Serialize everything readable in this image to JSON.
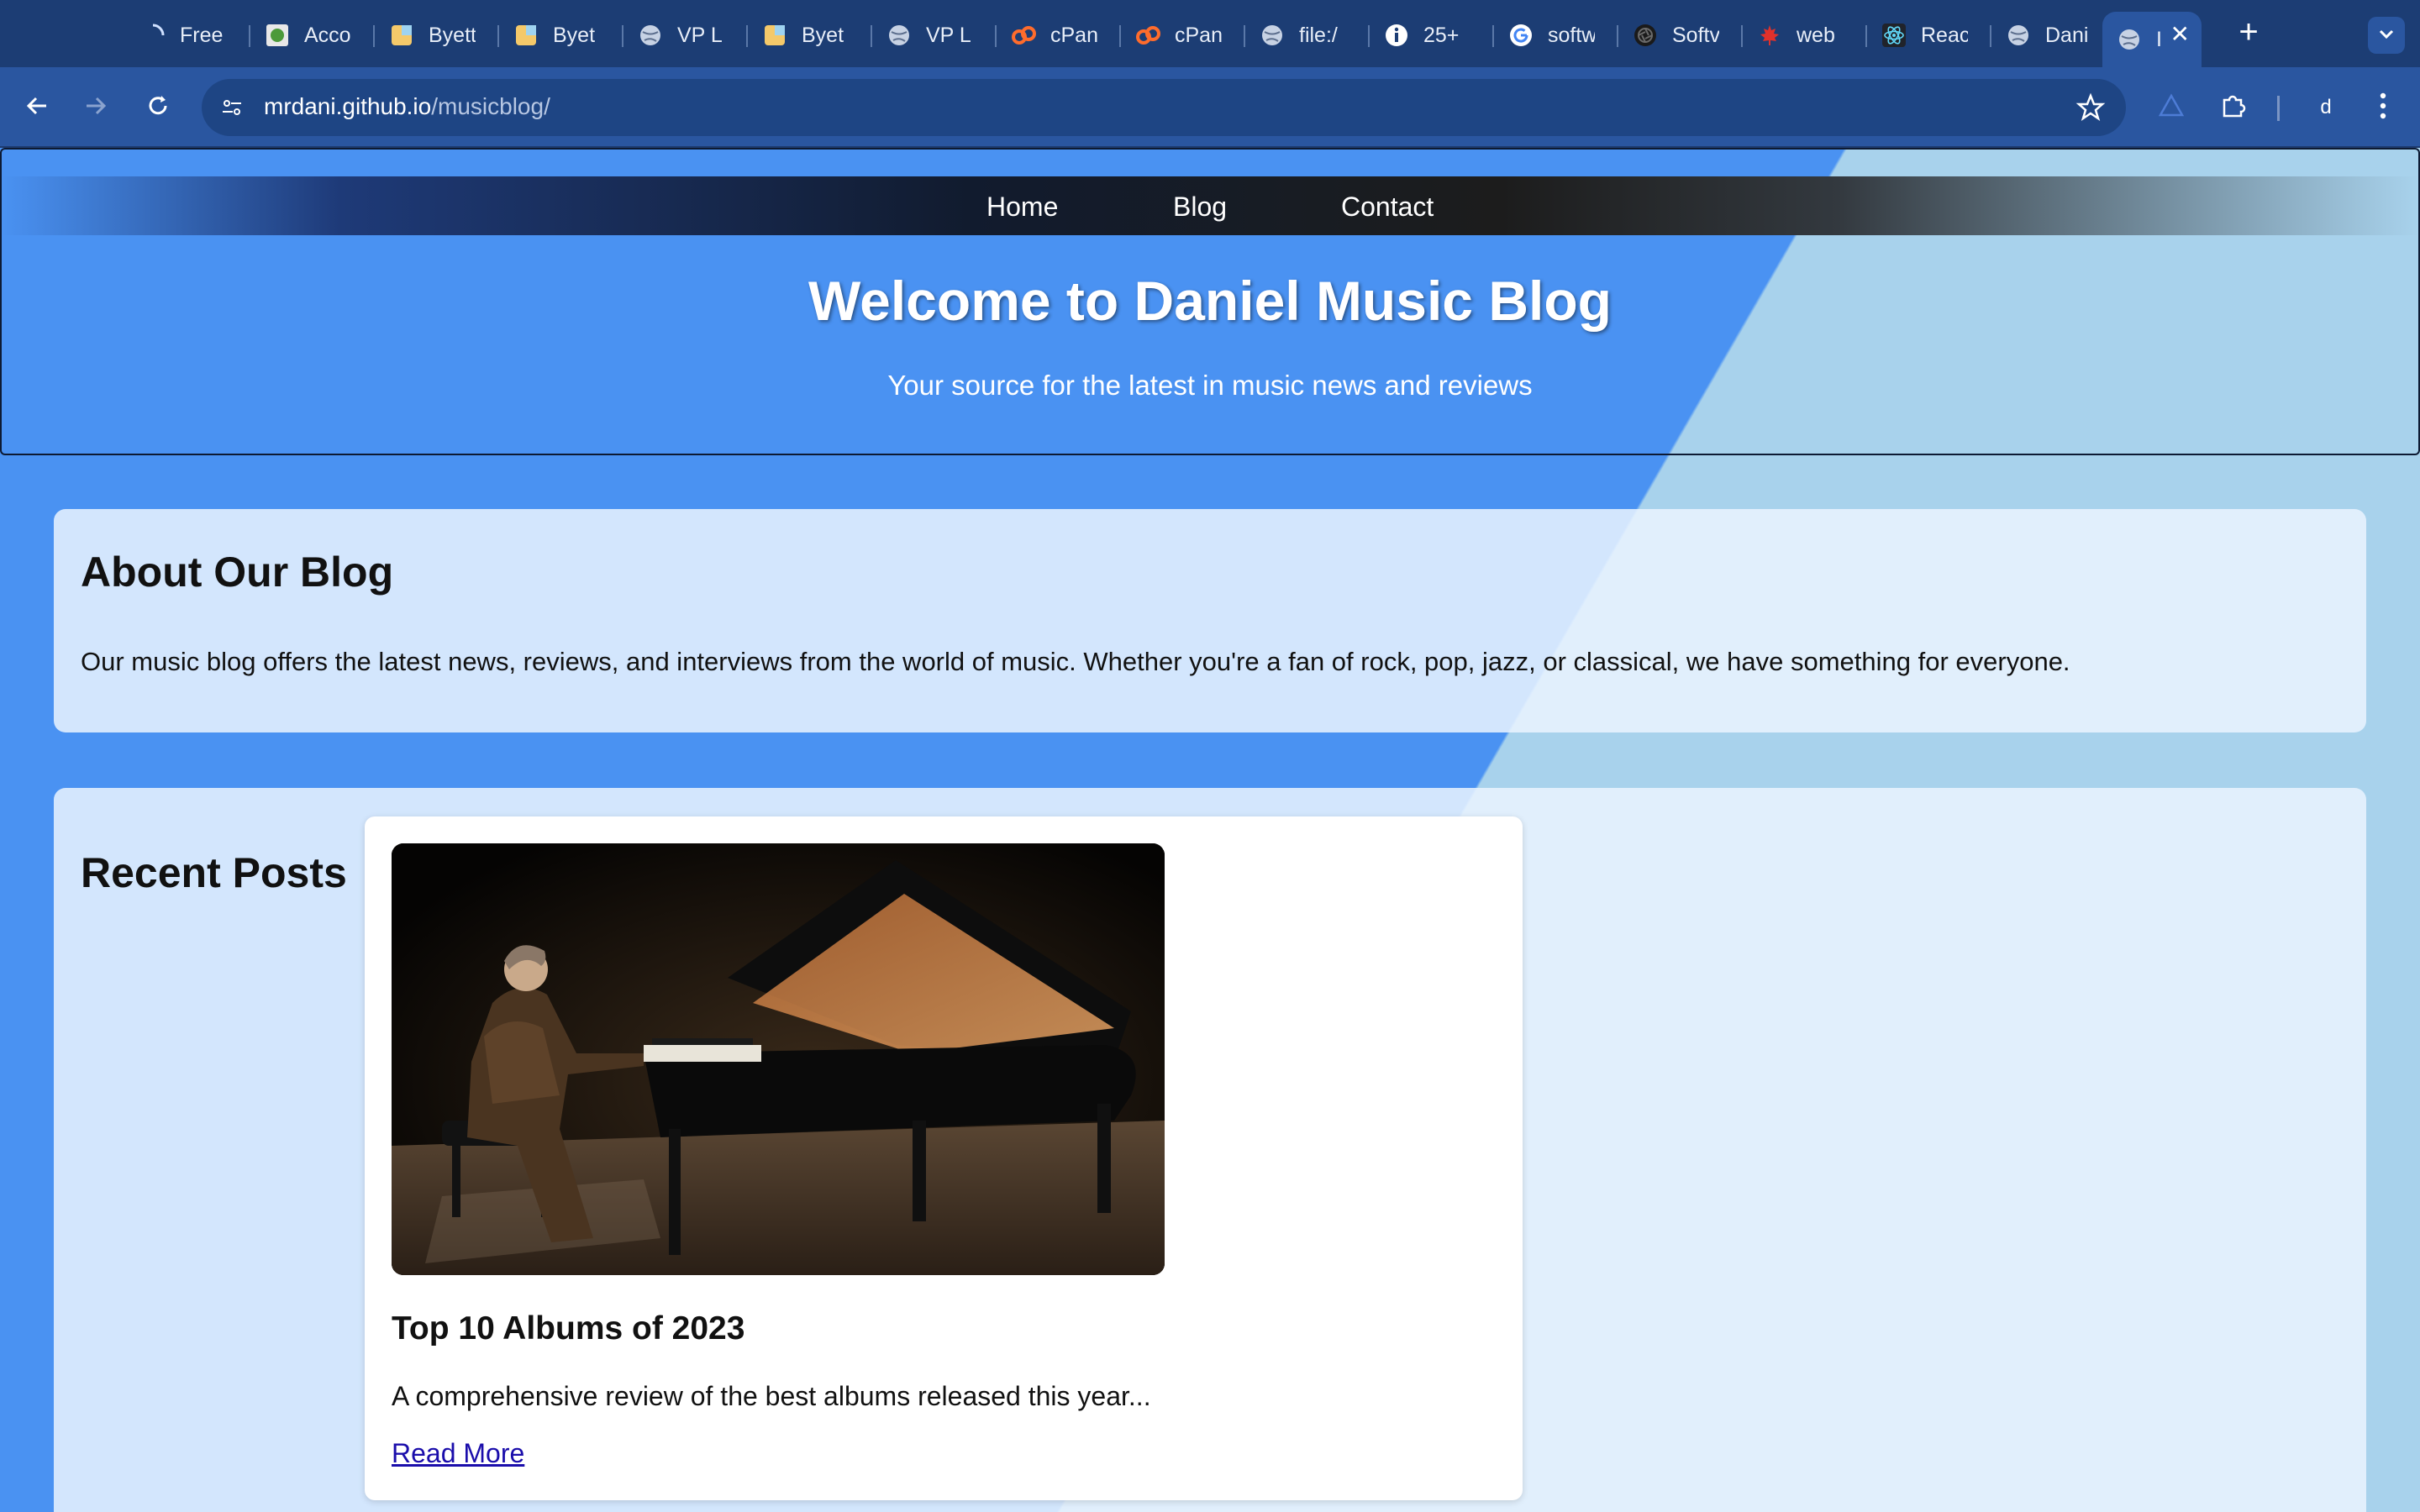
{
  "browser": {
    "tabs": [
      {
        "label": "Free",
        "icon": "loading-spinner-icon"
      },
      {
        "label": "Acco",
        "icon": "green-leaf-icon"
      },
      {
        "label": "Byett",
        "icon": "byet-host-icon"
      },
      {
        "label": "Byet",
        "icon": "byet-host-icon"
      },
      {
        "label": "VP L",
        "icon": "globe-icon"
      },
      {
        "label": "Byet",
        "icon": "byet-host-icon"
      },
      {
        "label": "VP L",
        "icon": "globe-icon"
      },
      {
        "label": "cPan",
        "icon": "cpanel-icon"
      },
      {
        "label": "cPan",
        "icon": "cpanel-icon"
      },
      {
        "label": "file:/",
        "icon": "globe-icon"
      },
      {
        "label": "25+",
        "icon": "info-icon"
      },
      {
        "label": "softw",
        "icon": "google-icon"
      },
      {
        "label": "Softv",
        "icon": "aperture-icon"
      },
      {
        "label": "web",
        "icon": "maple-leaf-icon"
      },
      {
        "label": "Reac",
        "icon": "react-icon"
      },
      {
        "label": "Dani",
        "icon": "globe-icon"
      }
    ],
    "active_tab": {
      "label": "I",
      "icon": "globe-icon",
      "close": "✕"
    },
    "new_tab": "+",
    "url_host": "mrdani.github.io",
    "url_path": "/musicblog/",
    "profile_initial": "d",
    "colors": {
      "frame": "#1c3d74",
      "toolbar": "#2a56a0",
      "omnibox": "#1e4584"
    }
  },
  "site": {
    "nav": [
      "Home",
      "Blog",
      "Contact"
    ],
    "hero_title": "Welcome to Daniel Music Blog",
    "hero_subtitle": "Your source for the latest in music news and reviews",
    "about": {
      "heading": "About Our Blog",
      "text": "Our music blog offers the latest news, reviews, and interviews from the world of music. Whether you're a fan of rock, pop, jazz, or classical, we have something for everyone."
    },
    "recent": {
      "heading": "Recent Posts",
      "posts": [
        {
          "image_alt": "pianist-at-grand-piano",
          "title": "Top 10 Albums of 2023",
          "excerpt": "A comprehensive review of the best albums released this year...",
          "link": "Read More"
        }
      ]
    },
    "colors": {
      "hero_blue": "#4a92f2",
      "light_blue": "#a8d2ec",
      "link": "#1a0dab"
    }
  }
}
